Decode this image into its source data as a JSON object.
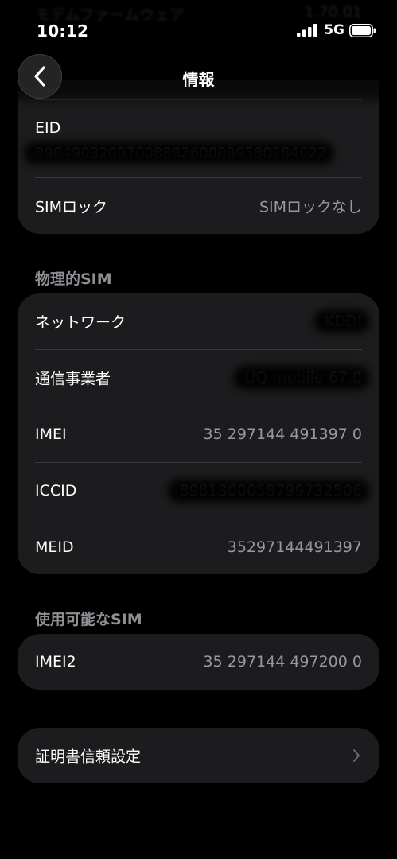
{
  "status_bar": {
    "time": "10:12",
    "network": "5G"
  },
  "background": {
    "ghost_label": "モデムファームウェア",
    "ghost_value": "1.70.01"
  },
  "nav": {
    "title": "情報",
    "back_icon": "chevron-left-icon"
  },
  "top_group": {
    "eid": {
      "label": "EID",
      "value": "89049032007008882600099580284022"
    },
    "sim_lock": {
      "label": "SIMロック",
      "value": "SIMロックなし"
    }
  },
  "physical_sim": {
    "header": "物理的SIM",
    "rows": [
      {
        "label": "ネットワーク",
        "value": "KDDI"
      },
      {
        "label": "通信事業者",
        "value": "UQ mobile 67.0"
      },
      {
        "label": "IMEI",
        "value": "35 297144 491397 0"
      },
      {
        "label": "ICCID",
        "value": "8981300058799732506"
      },
      {
        "label": "MEID",
        "value": "35297144491397"
      }
    ]
  },
  "available_sim": {
    "header": "使用可能なSIM",
    "rows": [
      {
        "label": "IMEI2",
        "value": "35 297144 497200 0"
      }
    ]
  },
  "certificate": {
    "label": "証明書信頼設定",
    "icon": "chevron-right-icon"
  },
  "colors": {
    "background": "#000000",
    "card": "#1c1c1e",
    "separator": "#3a3a3c",
    "secondary_text": "#98989f",
    "section_header": "#8e8e93"
  }
}
